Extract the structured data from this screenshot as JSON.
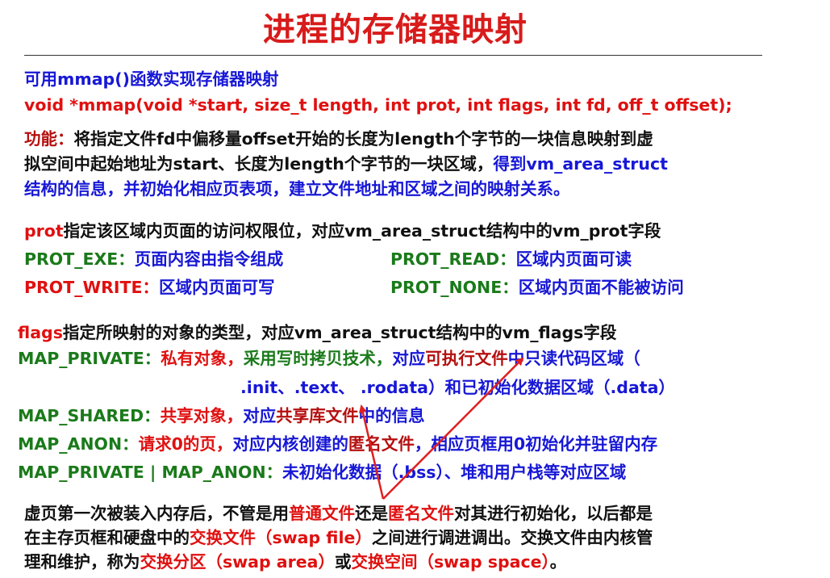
{
  "title": "进程的存储器映射",
  "intro": "可用mmap()函数实现存储器映射",
  "signature": "void *mmap(void *start, size_t length, int prot, int flags, int fd, off_t offset);",
  "function_desc": {
    "label": "功能：",
    "l1": "将指定文件fd中偏移量offset开始的长度为length个字节的一块信息映射到虚",
    "l2a": "拟空间中起始地址为start、长度为length个字节的一块区域，",
    "l2b": "得到vm_area_struct",
    "l3": "结构的信息，并初始化相应页表项，建立文件地址和区域之间的映射关系。"
  },
  "prot": {
    "keyword": "prot",
    "desc": "指定该区域内页面的访问权限位，对应vm_area_struct结构中的vm_prot字段",
    "items": [
      {
        "name": "PROT_EXE：",
        "desc": "页面内容由指令组成"
      },
      {
        "name": "PROT_READ：",
        "desc": "区域内页面可读"
      },
      {
        "name": "PROT_WRITE：",
        "desc": "区域内页面可写"
      },
      {
        "name": "PROT_NONE：",
        "desc": "区域内页面不能被访问"
      }
    ]
  },
  "flags": {
    "keyword": "flags",
    "desc": "指定所映射的对象的类型，对应vm_area_struct结构中的vm_flags字段",
    "private_name": "MAP_PRIVATE：",
    "private_a": "私有对象，",
    "private_b": "采用写时拷贝技术，",
    "private_c": "对应",
    "private_d": "可执行文件",
    "private_e": "中只读代码区域（",
    "private_l2": ".init、.text、 .rodata）和已初始化数据区域（.data）",
    "shared_name": "MAP_SHARED：",
    "shared_a": "共享对象，",
    "shared_b": "对应",
    "shared_c": "共享库文件",
    "shared_d": "中的信息",
    "anon_name": "MAP_ANON：",
    "anon_a": "请求0的页，",
    "anon_b": "对应内核创建的",
    "anon_c": "匿名文件",
    "anon_d": "，相应页框用0初始化并驻留内存",
    "pa_name": "MAP_PRIVATE | MAP_ANON：",
    "pa_desc": "未初始化数据（.bss）、堆和用户栈等对应区域"
  },
  "footer": {
    "l1a": "虚页第一次被装入内存后，不管是用",
    "l1b": "普通文件",
    "l1c": "还是",
    "l1d": "匿名文件",
    "l1e": "对其进行初始化，以后都是",
    "l2a": "在主存页框和硬盘中的",
    "l2b": "交换文件（swap file）",
    "l2c": "之间进行调进调出。交换文件由内核管",
    "l3a": "理和维护，称为",
    "l3b": "交换分区（swap area）",
    "l3c": "或",
    "l3d": "交换空间（swap space）",
    "l3e": "。"
  },
  "colors": {
    "title": "#d81b1b",
    "blue": "#1717d6",
    "red": "#e01010",
    "green": "#1a7a1a",
    "arrow": "#e02020"
  }
}
